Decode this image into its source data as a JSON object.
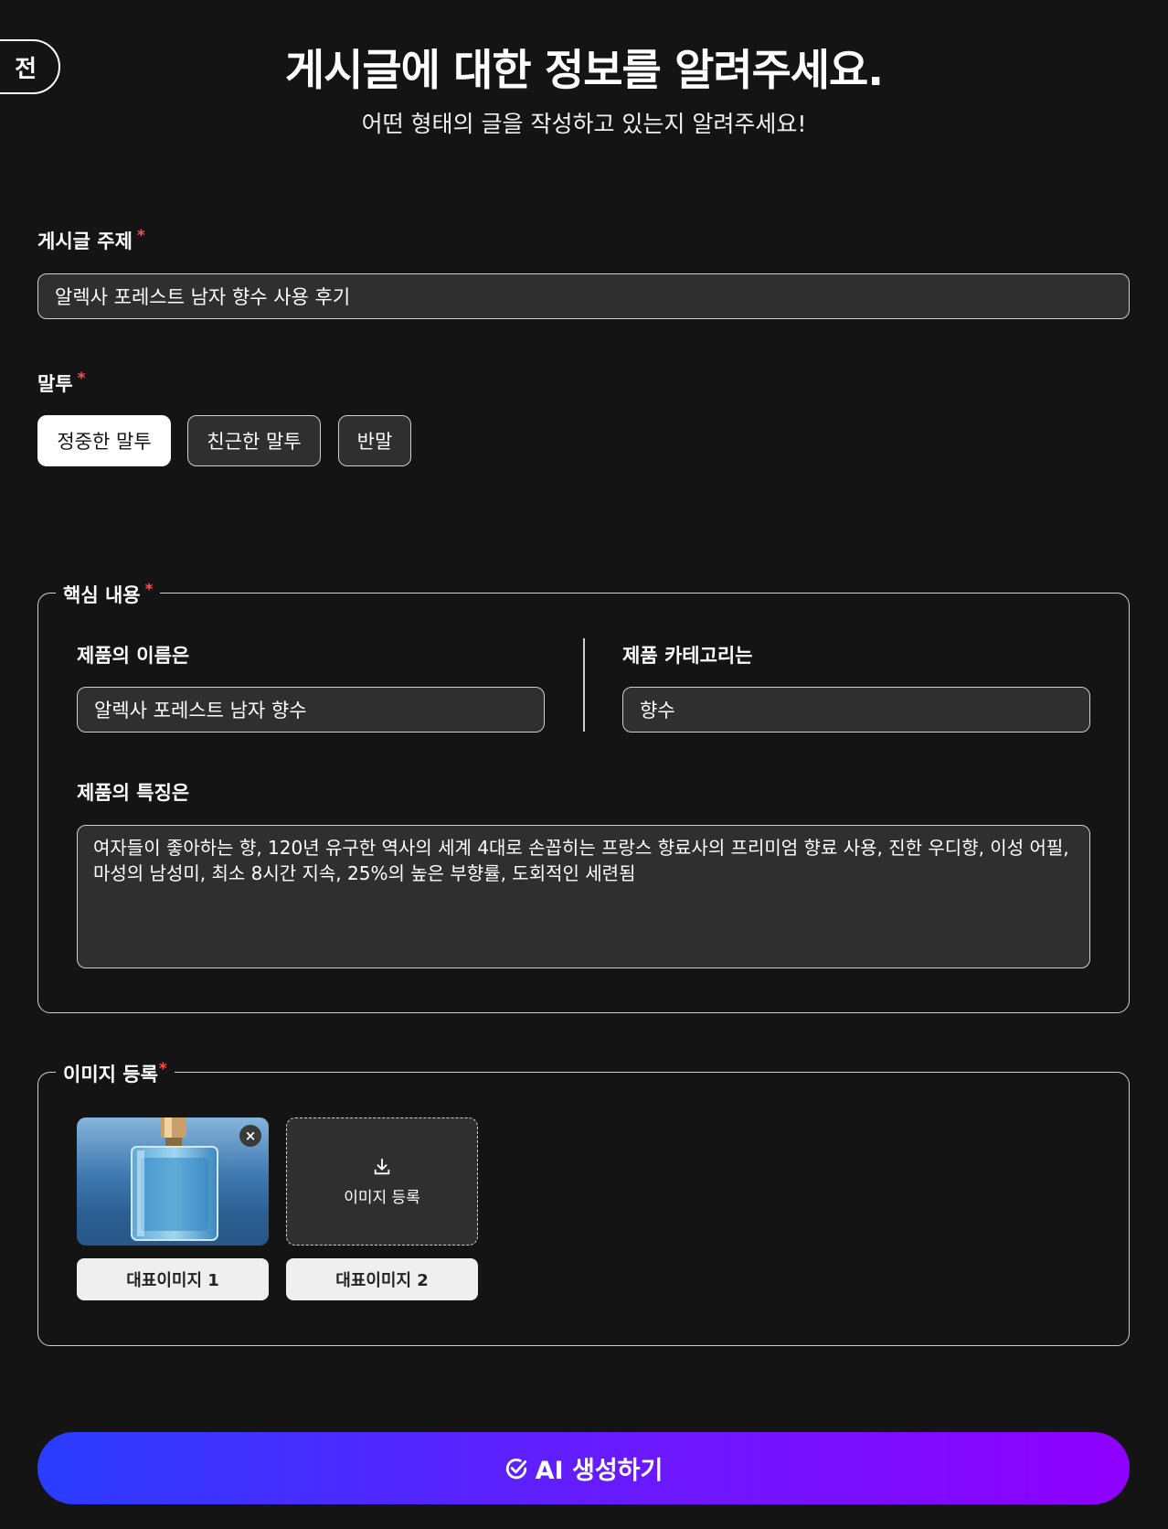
{
  "header": {
    "back_label": "전",
    "title": "게시글에 대한 정보를 알려주세요.",
    "subtitle": "어떤 형태의 글을 작성하고 있는지 알려주세요!"
  },
  "topic": {
    "label": "게시글 주제",
    "required_mark": "*",
    "value": "알렉사 포레스트 남자 향수 사용 후기"
  },
  "tone": {
    "label": "말투",
    "required_mark": "*",
    "options": [
      "정중한 말투",
      "친근한 말투",
      "반말"
    ],
    "selected": "정중한 말투"
  },
  "core": {
    "legend": "핵심 내용",
    "required_mark": "*",
    "product_name_label": "제품의 이름은",
    "product_name_value": "알렉사 포레스트 남자 향수",
    "category_label": "제품 카테고리는",
    "category_value": "향수",
    "features_label": "제품의 특징은",
    "features_value": "여자들이 좋아하는 향, 120년 유구한 역사의 세계 4대로 손꼽히는 프랑스 향료사의 프리미엄 향료 사용, 진한 우디향, 이성 어필, 마성의 남성미, 최소 8시간 지속, 25%의 높은 부향률, 도회적인 세련됨"
  },
  "images": {
    "legend": "이미지 등록",
    "required_mark": "*",
    "upload_label": "이미지 등록",
    "remove_symbol": "×",
    "rep_buttons": [
      "대표이미지 1",
      "대표이미지 2"
    ]
  },
  "submit": {
    "label": "AI 생성하기"
  },
  "colors": {
    "background": "#141415",
    "field_bg": "#2f2f30",
    "required": "#ff4d4d",
    "gradient_start": "#2a3dff",
    "gradient_end": "#8f00ff"
  }
}
